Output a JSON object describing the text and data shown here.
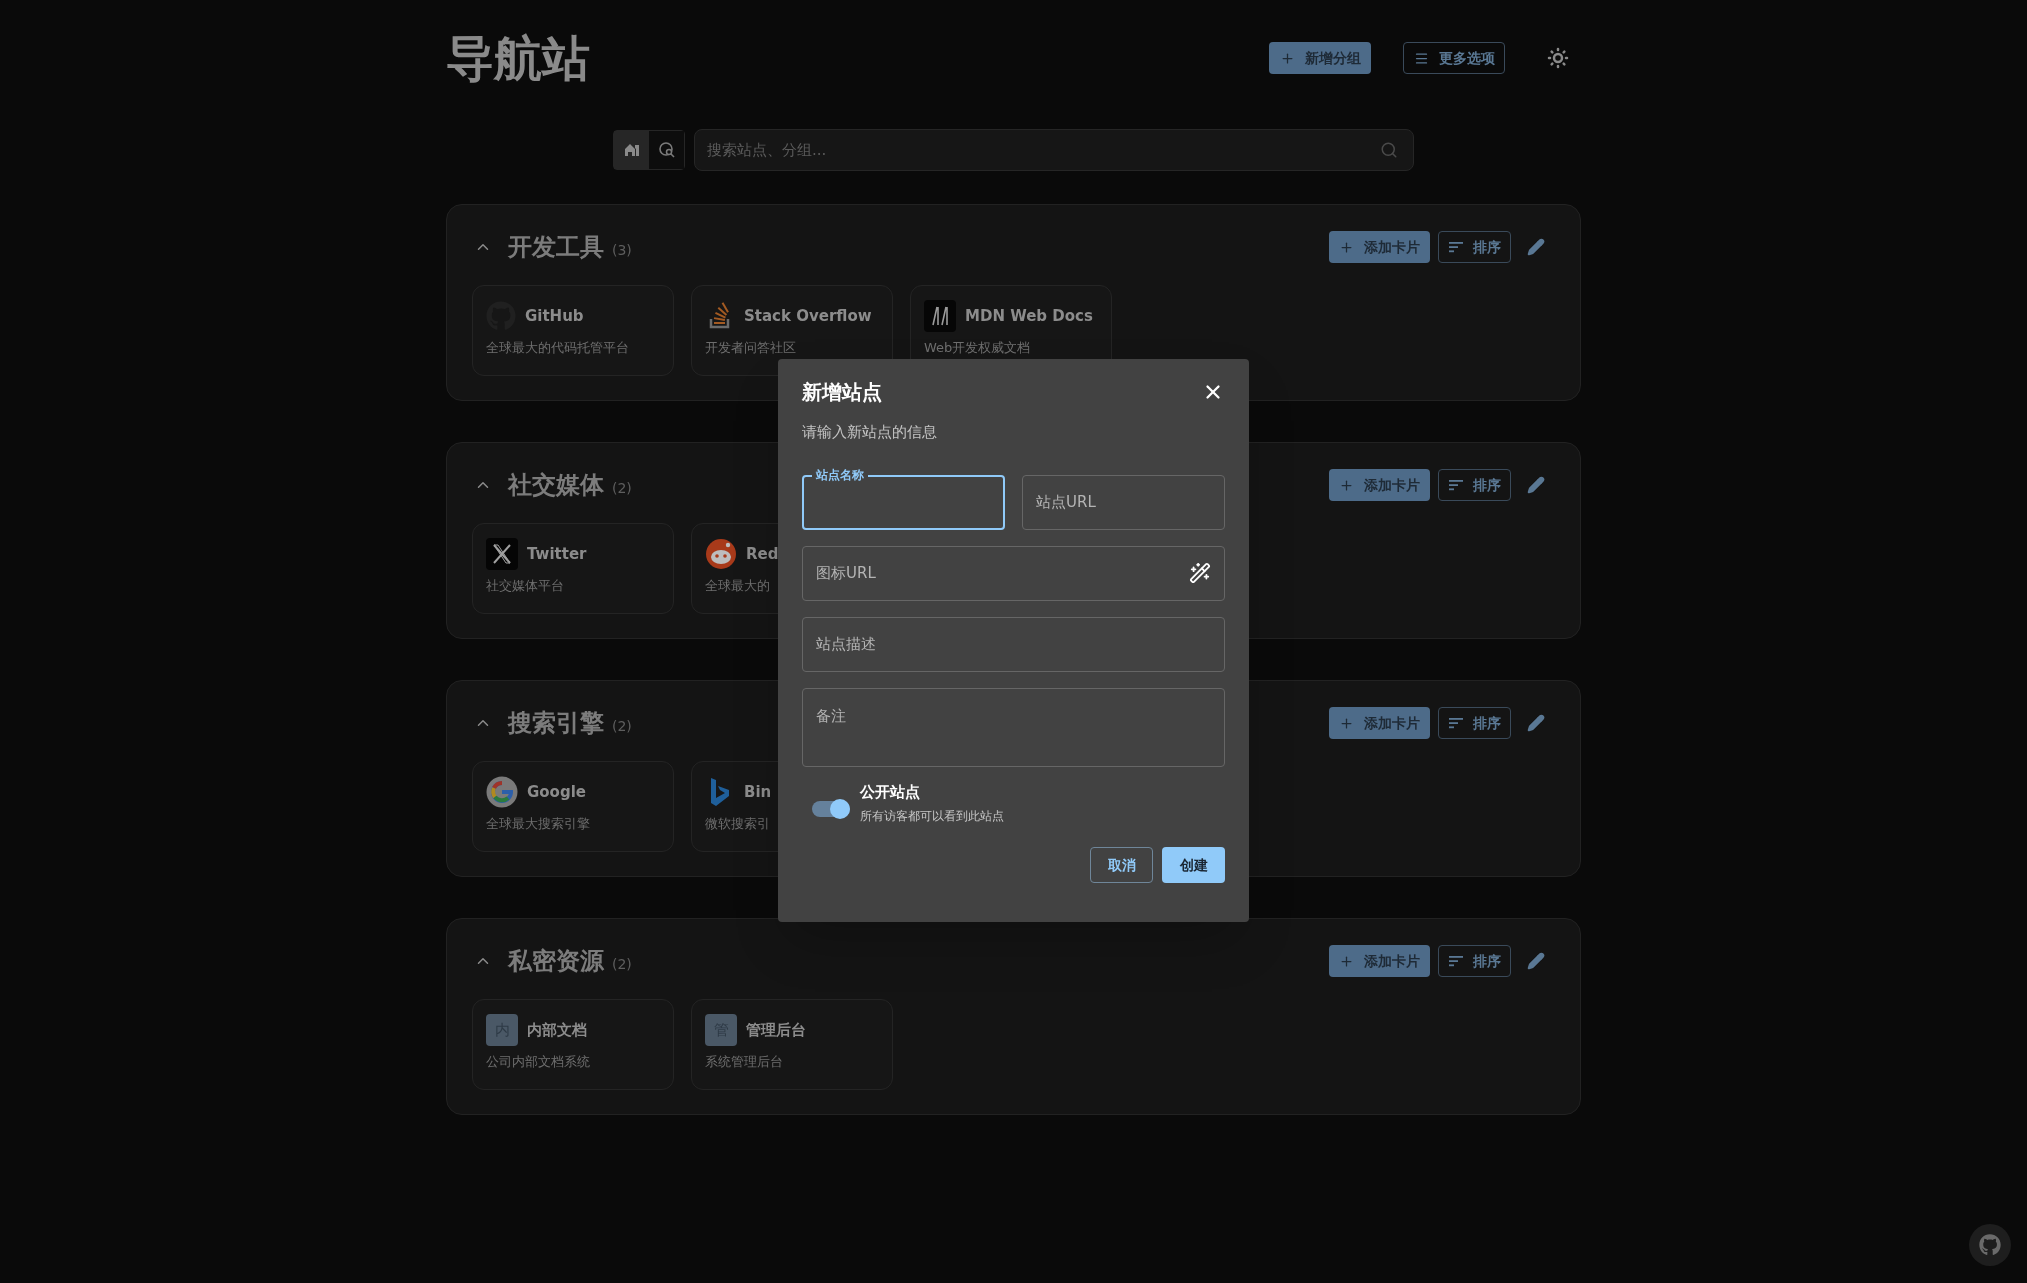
{
  "app_title": "导航站",
  "header_buttons": [
    {
      "kind": "primary",
      "label": "新增分组"
    },
    {
      "kind": "outlined",
      "label": "更多选项"
    }
  ],
  "search": {
    "placeholder": "搜索站点、分组...",
    "modes": [
      {
        "kind": "site",
        "selected": true
      },
      {
        "kind": "web",
        "selected": false
      }
    ]
  },
  "groups": [
    {
      "name": "开发工具",
      "count": "(3)",
      "expanded": true,
      "add_label": "添加卡片",
      "sort_label": "排序",
      "sites": [
        {
          "kind": "github",
          "name": "GitHub",
          "description": "全球最大的代码托管平台"
        },
        {
          "kind": "stackoverflow",
          "name": "Stack Overflow",
          "description": "开发者问答社区"
        },
        {
          "kind": "mdn",
          "name": "MDN Web Docs",
          "description": "Web开发权威文档"
        }
      ]
    },
    {
      "name": "社交媒体",
      "count": "(2)",
      "expanded": true,
      "add_label": "添加卡片",
      "sort_label": "排序",
      "sites": [
        {
          "kind": "x",
          "name": "Twitter",
          "description": "社交媒体平台"
        },
        {
          "kind": "reddit",
          "name": "Red",
          "description": "全球最大的"
        }
      ]
    },
    {
      "name": "搜索引擎",
      "count": "(2)",
      "expanded": true,
      "add_label": "添加卡片",
      "sort_label": "排序",
      "sites": [
        {
          "kind": "google",
          "name": "Google",
          "description": "全球最大搜索引擎"
        },
        {
          "kind": "bing",
          "name": "Bin",
          "description": "微软搜索引"
        }
      ]
    },
    {
      "name": "私密资源",
      "count": "(2)",
      "expanded": true,
      "add_label": "添加卡片",
      "sort_label": "排序",
      "sites": [
        {
          "kind": "letter",
          "icon_text": "内",
          "name": "内部文档",
          "description": "公司内部文档系统"
        },
        {
          "kind": "letter",
          "icon_text": "管",
          "name": "管理后台",
          "description": "系统管理后台"
        }
      ]
    }
  ],
  "dialog": {
    "title": "新增站点",
    "subtitle": "请输入新站点的信息",
    "fields": [
      {
        "kind": "half",
        "label": "站点名称",
        "focused": true
      },
      {
        "kind": "half",
        "label": "站点URL",
        "focused": false
      },
      {
        "kind": "icon",
        "label": "图标URL",
        "focused": false
      },
      {
        "kind": "full",
        "label": "站点描述",
        "focused": false
      },
      {
        "kind": "multiline",
        "label": "备注",
        "focused": false
      }
    ],
    "toggle": {
      "label": "公开站点",
      "hint": "所有访客都可以看到此站点",
      "on": true
    },
    "buttons": [
      {
        "kind": "outlined",
        "label": "取消"
      },
      {
        "kind": "primary",
        "label": "创建"
      }
    ]
  }
}
